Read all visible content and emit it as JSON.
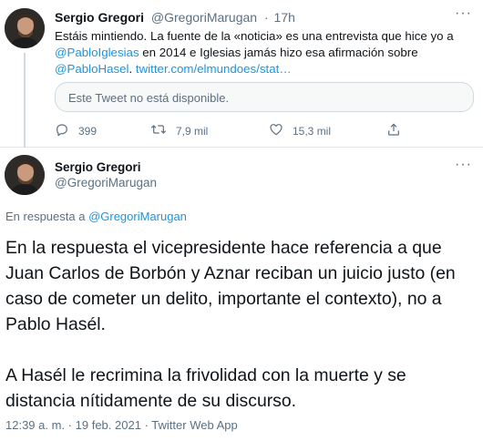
{
  "quoted_tweet": {
    "author_name": "Sergio Gregori",
    "author_handle": "@GregoriMarugan",
    "separator": "·",
    "time_ago": "17h",
    "text_part1": "Estáis mintiendo. La fuente de la «noticia» es una entrevista que hice yo a ",
    "mention1": "@PabloIglesias",
    "text_part2": " en 2014 e Iglesias jamás hizo esa afirmación sobre ",
    "mention2": "@PabloHasel",
    "text_part3": ". ",
    "link": "twitter.com/elmundoes/stat…",
    "unavailable_text": "Este Tweet no está disponible.",
    "more_label": "···",
    "actions": {
      "replies": "399",
      "retweets": "7,9 mil",
      "likes": "15,3 mil"
    }
  },
  "main_tweet": {
    "author_name": "Sergio Gregori",
    "author_handle": "@GregoriMarugan",
    "more_label": "···",
    "reply_prefix": "En respuesta a ",
    "reply_to": "@GregoriMarugan",
    "paragraph1": "En la respuesta el vicepresidente hace referencia a que Juan Carlos de Borbón y Aznar reciban un juicio justo (en caso de cometer un delito, importante el contexto), no a Pablo Hasél.",
    "paragraph2": "A Hasél le recrimina la frivolidad con la muerte y se distancia nítidamente de su discurso.",
    "time": "12:39 a. m.",
    "date": "19 feb. 2021",
    "source": "Twitter Web App",
    "separator": "·"
  },
  "colors": {
    "link": "#1b95e0",
    "secondary_text": "#5b7083",
    "border": "#e1e8ed"
  },
  "icons": {
    "reply": "reply-icon",
    "retweet": "retweet-icon",
    "like": "heart-icon",
    "share": "share-icon",
    "more": "more-icon"
  }
}
